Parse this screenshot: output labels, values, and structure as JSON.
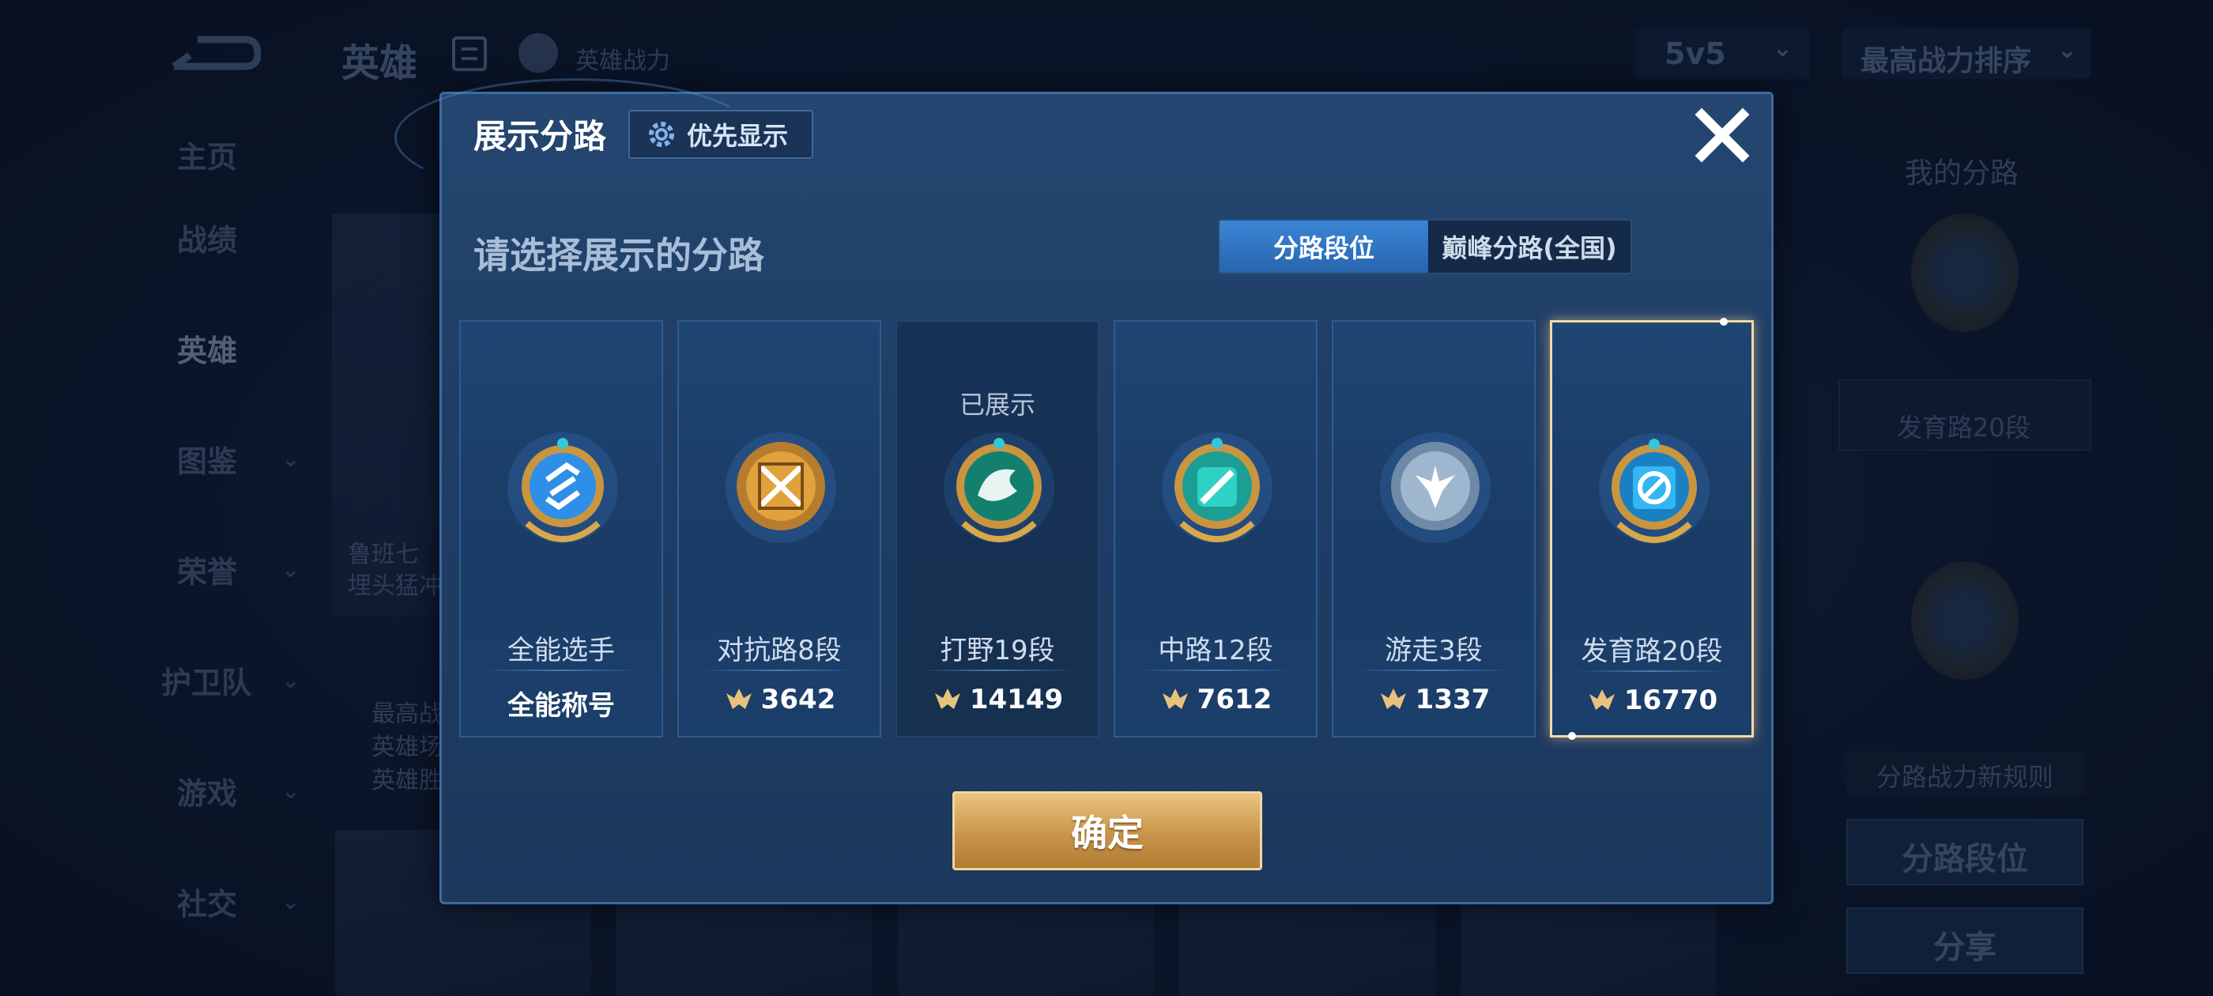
{
  "topbar": {
    "title": "英雄",
    "power_label": "英雄战力",
    "mode": "5v5",
    "sort": "最高战力排序"
  },
  "leftnav": {
    "items": [
      {
        "label": "主页"
      },
      {
        "label": "战绩"
      },
      {
        "label": "英雄"
      },
      {
        "label": "图鉴"
      },
      {
        "label": "荣誉"
      },
      {
        "label": "护卫队"
      },
      {
        "label": "游戏"
      },
      {
        "label": "社交"
      }
    ]
  },
  "background": {
    "hero_name_partial": "鲁班七",
    "hero_desc_partial": "埋头猛冲",
    "stats_line1": "最高战",
    "stats_line2": "英雄场",
    "stats_line3": "英雄胜"
  },
  "right_panel": {
    "title": "我的分路",
    "label": "发育路20段",
    "rule": "分路战力新规则",
    "btn_segment": "分路段位",
    "btn_share": "分享"
  },
  "modal": {
    "title": "展示分路",
    "priority_label": "优先显示",
    "subtitle": "请选择展示的分路",
    "tabs": {
      "active": "分路段位",
      "inactive": "巅峰分路(全国)"
    },
    "shown_label": "已展示",
    "cards": [
      {
        "name": "全能选手",
        "value": "全能称号",
        "icon": "all-round-badge-icon",
        "color": "#2f8ee8"
      },
      {
        "name": "对抗路8段",
        "value": "3642",
        "icon": "clash-lane-badge-icon",
        "color": "#e0a23c"
      },
      {
        "name": "打野19段",
        "value": "14149",
        "icon": "jungle-badge-icon",
        "color": "#1fb39a"
      },
      {
        "name": "中路12段",
        "value": "7612",
        "icon": "mid-lane-badge-icon",
        "color": "#2fd1c4"
      },
      {
        "name": "游走3段",
        "value": "1337",
        "icon": "roam-badge-icon",
        "color": "#9fb6cf"
      },
      {
        "name": "发育路20段",
        "value": "16770",
        "icon": "farm-lane-badge-icon",
        "color": "#34b6f0"
      }
    ],
    "confirm": "确定"
  }
}
